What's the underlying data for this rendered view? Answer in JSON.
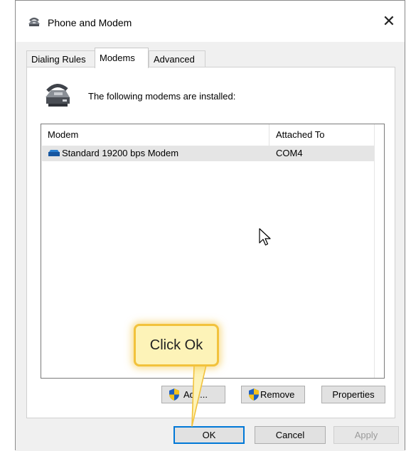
{
  "window": {
    "title": "Phone and Modem",
    "close_glyph": "✕"
  },
  "tabs": [
    {
      "label": "Dialing Rules",
      "active": false
    },
    {
      "label": "Modems",
      "active": true
    },
    {
      "label": "Advanced",
      "active": false
    }
  ],
  "panel": {
    "intro": "The following modems are installed:",
    "columns": [
      "Modem",
      "Attached To"
    ],
    "rows": [
      {
        "modem": "Standard 19200 bps Modem",
        "attached_to": "COM4",
        "selected": true
      }
    ],
    "buttons": {
      "add": "Add...",
      "remove": "Remove",
      "properties": "Properties"
    }
  },
  "footer": {
    "ok": "OK",
    "cancel": "Cancel",
    "apply": "Apply"
  },
  "callout": {
    "text": "Click Ok",
    "fill_color": "#fdf3b8",
    "border_color": "#f2c23c"
  },
  "colors": {
    "accent": "#0078d7",
    "selection": "#e5e5e5",
    "client_bg": "#f0f0f0"
  },
  "icons": {
    "app": "phone-modem-icon",
    "modem_device": "modem-device-icon",
    "shield": "uac-shield-icon",
    "cursor": "mouse-pointer-icon"
  }
}
